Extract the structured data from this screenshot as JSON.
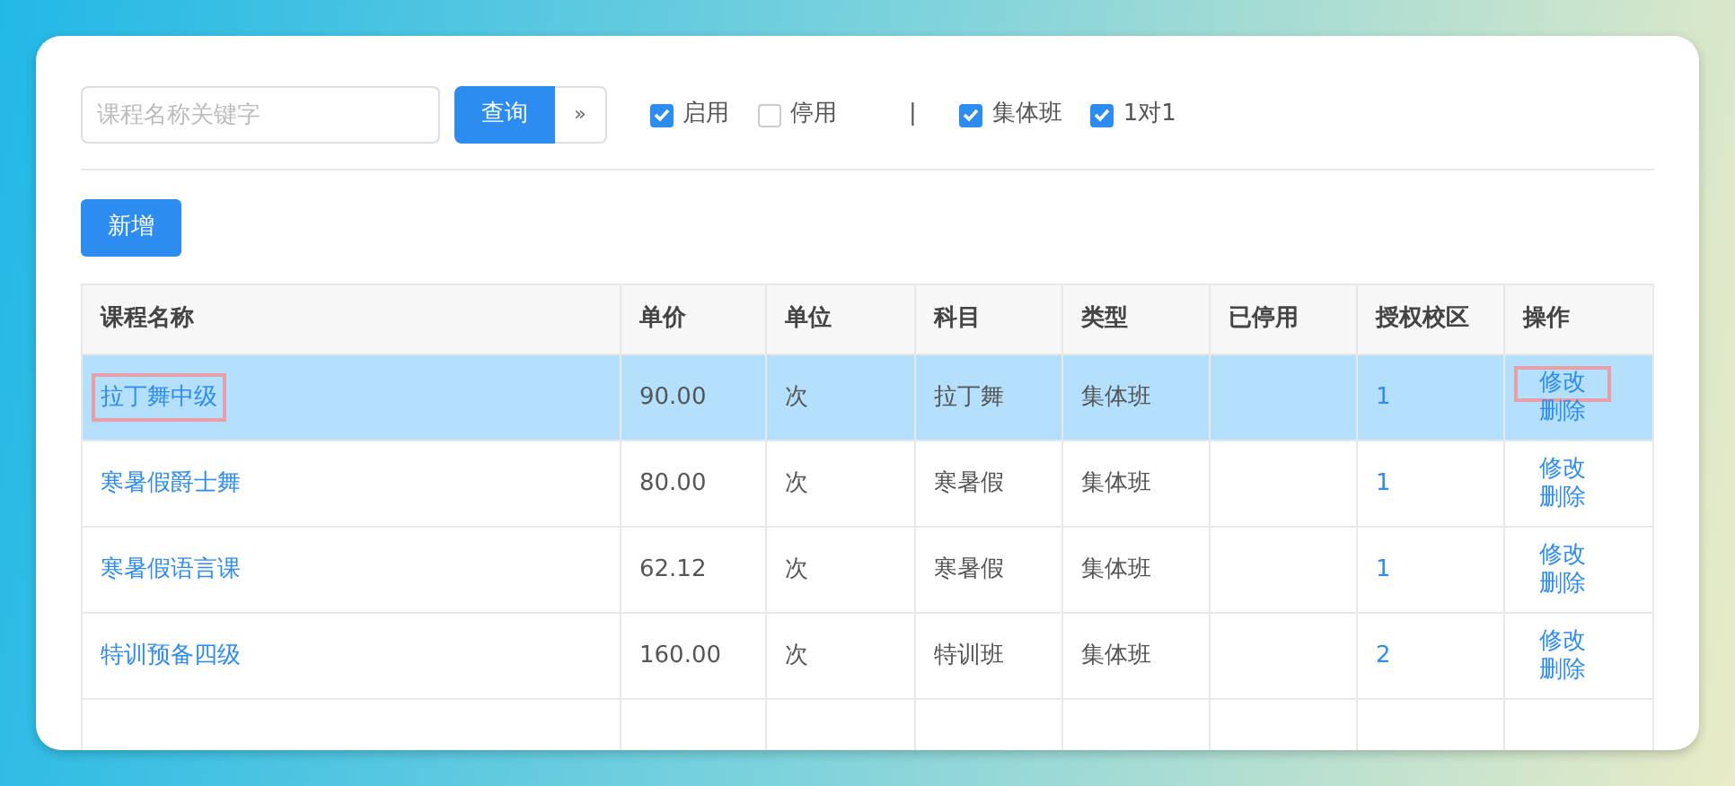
{
  "search": {
    "placeholder": "课程名称关键字",
    "button": "查询",
    "toggle": "»"
  },
  "filters": [
    {
      "label": "启用",
      "checked": true
    },
    {
      "label": "停用",
      "checked": false
    },
    {
      "kind": "separator",
      "label": "|"
    },
    {
      "label": "集体班",
      "checked": true
    },
    {
      "label": "1对1",
      "checked": true
    }
  ],
  "add_button": "新增",
  "table": {
    "columns": [
      "课程名称",
      "单价",
      "单位",
      "科目",
      "类型",
      "已停用",
      "授权校区",
      "操作"
    ],
    "rows": [
      {
        "selected": true,
        "name": "拉丁舞中级",
        "name_highlighted": true,
        "price": "90.00",
        "unit": "次",
        "subject": "拉丁舞",
        "type": "集体班",
        "campuses": "1",
        "actions": [
          {
            "label": "修改",
            "highlighted": true
          },
          {
            "label": "删除",
            "highlighted": false
          }
        ]
      },
      {
        "selected": false,
        "name": "寒暑假爵士舞",
        "name_highlighted": false,
        "price": "80.00",
        "unit": "次",
        "subject": "寒暑假",
        "type": "集体班",
        "campuses": "1",
        "actions": [
          {
            "label": "修改",
            "highlighted": false
          },
          {
            "label": "删除",
            "highlighted": false
          }
        ]
      },
      {
        "selected": false,
        "name": "寒暑假语言课",
        "name_highlighted": false,
        "price": "62.12",
        "unit": "次",
        "subject": "寒暑假",
        "type": "集体班",
        "campuses": "1",
        "actions": [
          {
            "label": "修改",
            "highlighted": false
          },
          {
            "label": "删除",
            "highlighted": false
          }
        ]
      },
      {
        "selected": false,
        "name": "特训预备四级",
        "name_highlighted": false,
        "price": "160.00",
        "unit": "次",
        "subject": "特训班",
        "type": "集体班",
        "campuses": "2",
        "actions": [
          {
            "label": "修改",
            "highlighted": false
          },
          {
            "label": "删除",
            "highlighted": false
          }
        ]
      }
    ]
  }
}
